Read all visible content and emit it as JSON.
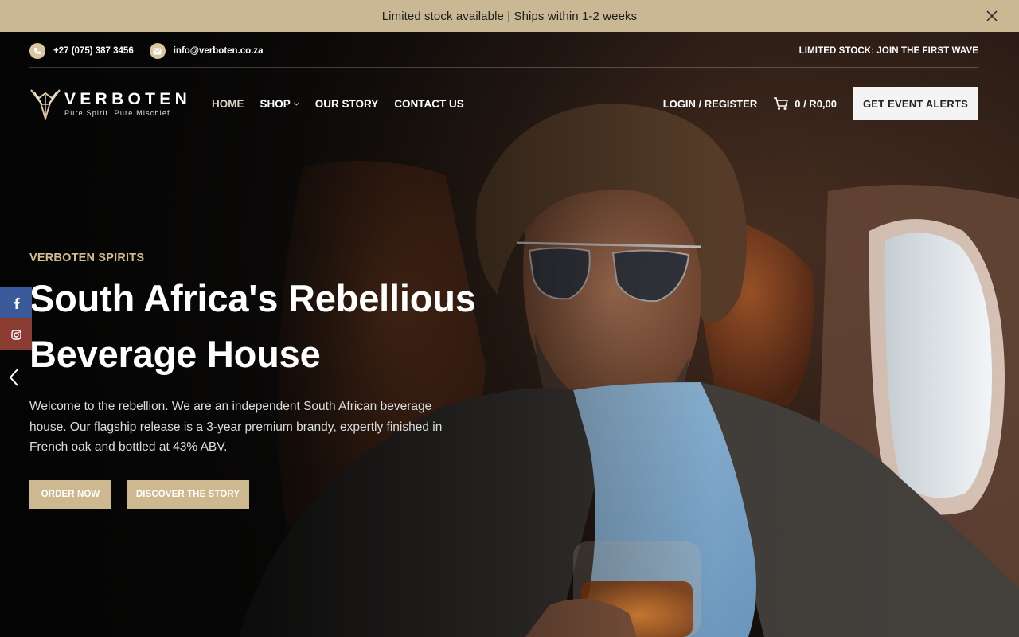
{
  "promo": {
    "message": "Limited stock available | Ships within 1-2 weeks",
    "close_icon": "close-icon"
  },
  "topbar": {
    "phone": "+27 (075) 387 3456",
    "email": "info@verboten.co.za",
    "notice": "LIMITED STOCK: JOIN THE FIRST WAVE"
  },
  "brand": {
    "name": "VERBOTEN",
    "tagline": "Pure Spirit.  Pure Mischief."
  },
  "nav": {
    "items": [
      {
        "label": "HOME",
        "active": true
      },
      {
        "label": "SHOP",
        "has_dropdown": true
      },
      {
        "label": "OUR STORY"
      },
      {
        "label": "CONTACT US"
      }
    ]
  },
  "header": {
    "login": "LOGIN / REGISTER",
    "cart": "0 / R0,00",
    "cta": "GET EVENT ALERTS"
  },
  "hero": {
    "eyebrow": "VERBOTEN SPIRITS",
    "title_line1": "South Africa's Rebellious",
    "title_line2": "Beverage House",
    "intro_line1": "Welcome to the rebellion. We are an independent South African beverage",
    "intro_line2": "house. Our flagship release is a 3-year premium brandy, expertly finished in",
    "intro_line3": "French oak and bottled at 43% ABV.",
    "primary_button": "ORDER NOW",
    "secondary_button": "DISCOVER THE STORY"
  },
  "social": {
    "facebook_icon": "facebook-icon",
    "instagram_icon": "instagram-icon"
  },
  "colors": {
    "promo_bg": "#c9b893",
    "accent_gold": "#cdb88f",
    "eyebrow_gold": "#d2bd8d",
    "facebook": "#3b5a9a",
    "instagram": "#8a3b32"
  }
}
